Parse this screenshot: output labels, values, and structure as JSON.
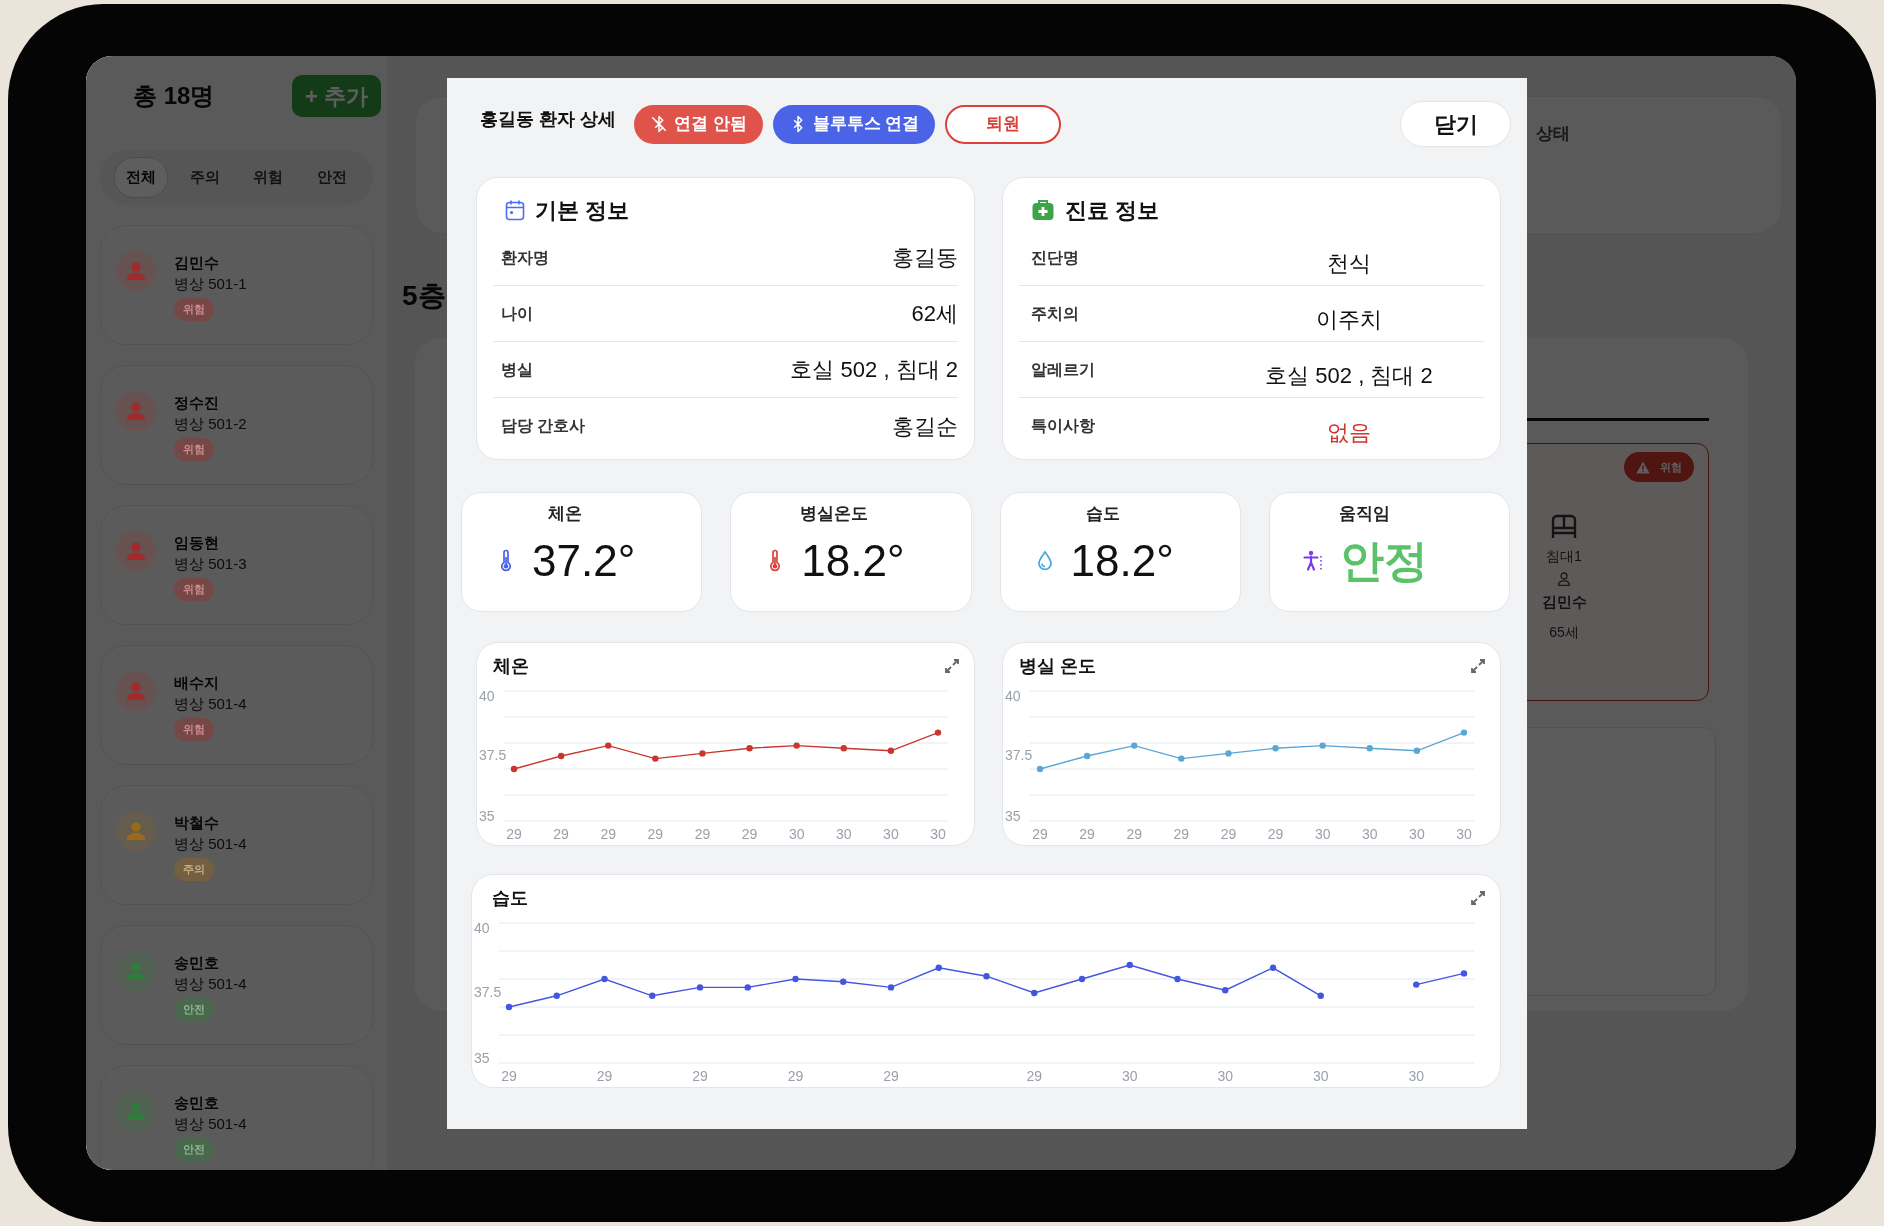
{
  "sidebar": {
    "total": "총 18명",
    "add_button": "+ 추가",
    "filters": [
      {
        "label": "전체",
        "selected": true
      },
      {
        "label": "주의",
        "selected": false
      },
      {
        "label": "위험",
        "selected": false
      },
      {
        "label": "안전",
        "selected": false
      }
    ],
    "patients": [
      {
        "name": "김민수",
        "bed": "병상 501-1",
        "status": "위험",
        "color": "#a12b2b"
      },
      {
        "name": "정수진",
        "bed": "병상 501-2",
        "status": "위험",
        "color": "#a12b2b"
      },
      {
        "name": "임동현",
        "bed": "병상 501-3",
        "status": "위험",
        "color": "#a12b2b"
      },
      {
        "name": "배수지",
        "bed": "병상 501-4",
        "status": "위험",
        "color": "#a12b2b"
      },
      {
        "name": "박철수",
        "bed": "병상 501-4",
        "status": "주의",
        "color": "#9a6a1c"
      },
      {
        "name": "송민호",
        "bed": "병상 501-4",
        "status": "안전",
        "color": "#2f7d3a"
      },
      {
        "name": "송민호",
        "bed": "병상 501-4",
        "status": "안전",
        "color": "#2f7d3a"
      }
    ]
  },
  "main": {
    "status_card": {
      "label": "상태"
    },
    "floor": "5층",
    "bed_card": {
      "badge": "위험",
      "bed": "침대1",
      "patient": "김민수",
      "age": "65세"
    }
  },
  "dialog": {
    "title": "홍길동 환자 상세",
    "badges": [
      {
        "label": "연결 안됨",
        "kind": "disconnected"
      },
      {
        "label": "블루투스 연결",
        "kind": "connect"
      },
      {
        "label": "퇴원",
        "kind": "discharge"
      }
    ],
    "close_button": "닫기",
    "info_cards": [
      {
        "kind": "basic",
        "title": "기본 정보",
        "rows": [
          {
            "label": "환자명",
            "value": "홍길동",
            "highlight": false
          },
          {
            "label": "나이",
            "value": "62세",
            "highlight": false
          },
          {
            "label": "병실",
            "value": "호실 502 , 침대 2",
            "highlight": false
          },
          {
            "label": "담당 간호사",
            "value": "홍길순",
            "highlight": false
          }
        ]
      },
      {
        "kind": "medical",
        "title": "진료 정보",
        "rows": [
          {
            "label": "진단명",
            "value": "천식",
            "highlight": false
          },
          {
            "label": "주치의",
            "value": "이주치",
            "highlight": false
          },
          {
            "label": "알레르기",
            "value": "호실 502 , 침대 2",
            "highlight": false
          },
          {
            "label": "특이사항",
            "value": "없음",
            "highlight": true
          }
        ]
      }
    ],
    "vitals": [
      {
        "kind": "body-temp",
        "label": "체온",
        "value": "37.2°"
      },
      {
        "kind": "room-temp",
        "label": "병실온도",
        "value": "18.2°"
      },
      {
        "kind": "humidity",
        "label": "습도",
        "value": "18.2°"
      },
      {
        "kind": "motion",
        "label": "움직임",
        "value": "안정"
      }
    ],
    "charts": [
      {
        "chart_data": {
          "type": "line",
          "title": "체온",
          "categories": [
            "29",
            "29",
            "29",
            "29",
            "29",
            "29",
            "30",
            "30",
            "30",
            "30"
          ],
          "series": [
            {
              "color": "#c9362e",
              "marker": true,
              "values": [
                37.0,
                37.5,
                37.9,
                37.4,
                37.6,
                37.8,
                37.9,
                37.8,
                37.7,
                38.4
              ]
            }
          ],
          "ylim": [
            35,
            40
          ],
          "yticks": [
            35,
            37.5,
            40
          ]
        }
      },
      {
        "chart_data": {
          "type": "line",
          "title": "병실 온도",
          "categories": [
            "29",
            "29",
            "29",
            "29",
            "29",
            "29",
            "30",
            "30",
            "30",
            "30"
          ],
          "series": [
            {
              "color": "#5aa7d6",
              "marker": true,
              "values": [
                37.0,
                37.5,
                37.9,
                37.4,
                37.6,
                37.8,
                37.9,
                37.8,
                37.7,
                38.4
              ]
            }
          ],
          "ylim": [
            35,
            40
          ],
          "yticks": [
            35,
            37.5,
            40
          ]
        }
      },
      {
        "chart_data": {
          "type": "line",
          "title": "습도",
          "categories": [
            "29",
            null,
            "29",
            null,
            "29",
            null,
            "29",
            null,
            "29",
            null,
            null,
            "29",
            null,
            "30",
            null,
            "30",
            null,
            "30",
            null,
            "30",
            null
          ],
          "series": [
            {
              "color": "#4356e0",
              "marker": true,
              "values": [
                37.0,
                37.4,
                38.0,
                37.4,
                37.7,
                37.7,
                38.0,
                37.9,
                37.7,
                38.4,
                38.1,
                37.5,
                38.0,
                38.5,
                38.0,
                37.6,
                38.4,
                37.4,
                null,
                37.8,
                38.2
              ]
            }
          ],
          "ylim": [
            35,
            40
          ],
          "yticks": [
            35,
            37.5,
            40
          ]
        }
      }
    ]
  }
}
